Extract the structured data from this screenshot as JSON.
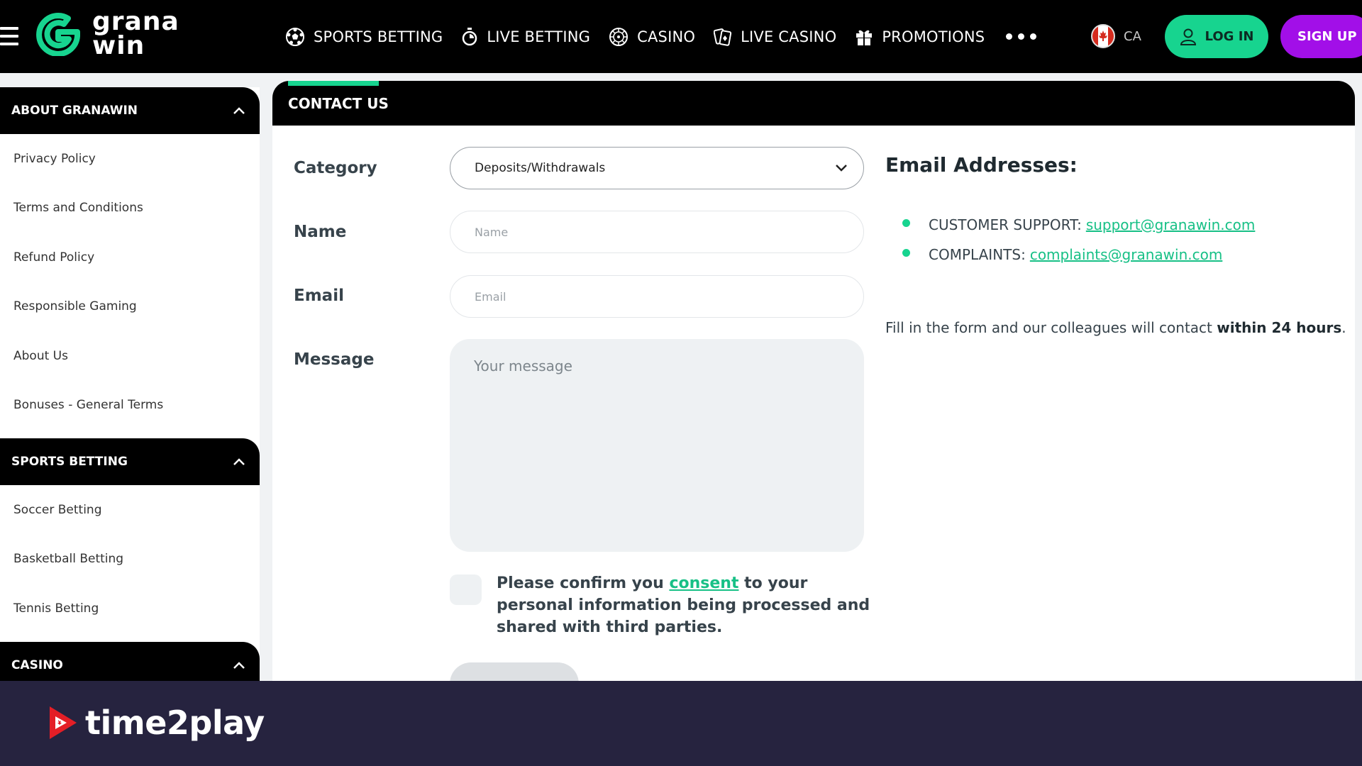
{
  "brand": {
    "logo_line1": "grana",
    "logo_line2": "win",
    "accent_green": "#17d48f",
    "accent_purple": "#a20fe8"
  },
  "nav": {
    "items": [
      {
        "label": "SPORTS BETTING",
        "icon": "soccer-ball-icon"
      },
      {
        "label": "LIVE BETTING",
        "icon": "stopwatch-icon"
      },
      {
        "label": "CASINO",
        "icon": "roulette-icon"
      },
      {
        "label": "LIVE CASINO",
        "icon": "cards-icon"
      },
      {
        "label": "PROMOTIONS",
        "icon": "gift-icon"
      }
    ],
    "locale": "CA",
    "login_label": "LOG IN",
    "signup_label": "SIGN UP"
  },
  "sidebar": {
    "sections": [
      {
        "title": "ABOUT GRANAWIN",
        "items": [
          "Privacy Policy",
          "Terms and Conditions",
          "Refund Policy",
          "Responsible Gaming",
          "About Us",
          "Bonuses - General Terms"
        ]
      },
      {
        "title": "SPORTS BETTING",
        "items": [
          "Soccer Betting",
          "Basketball Betting",
          "Tennis Betting"
        ]
      },
      {
        "title": "CASINO",
        "items": []
      }
    ]
  },
  "panel": {
    "title": "CONTACT US",
    "form": {
      "category_label": "Category",
      "category_value": "Deposits/Withdrawals",
      "name_label": "Name",
      "name_placeholder": "Name",
      "email_label": "Email",
      "email_placeholder": "Email",
      "message_label": "Message",
      "message_placeholder": "Your message",
      "consent_before": "Please confirm you ",
      "consent_link": "consent",
      "consent_after": " to your personal information being processed and shared with third parties."
    },
    "emails": {
      "title": "Email Addresses:",
      "list": [
        {
          "label": "CUSTOMER SUPPORT:",
          "address": "support@granawin.com"
        },
        {
          "label": "COMPLAINTS:",
          "address": "complaints@granawin.com"
        }
      ],
      "note_before": "Fill in the form and our colleagues will contact ",
      "note_bold": "within 24 hours",
      "note_after": "."
    }
  },
  "footer": {
    "brand": "time2play",
    "bg_color": "#26233f"
  }
}
